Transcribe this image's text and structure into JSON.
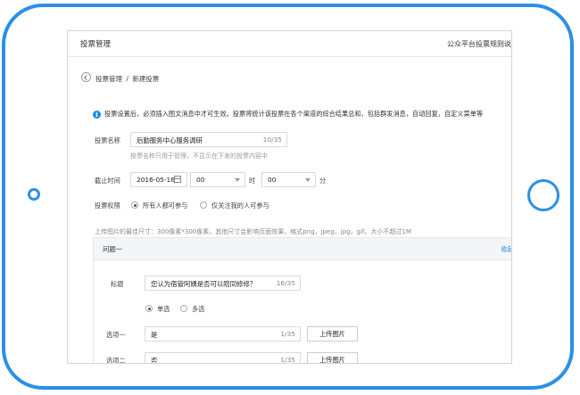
{
  "header": {
    "title": "投票管理",
    "rules_link": "公众平台投票规则说"
  },
  "breadcrumb": {
    "parent": "投票管理",
    "separator": "/",
    "current": "新建投票"
  },
  "notice": "投票设置后，必须插入图文消息中才可生效。投票将统计该投票在各个渠道的综合结果总和，包括群发消息，自动回复，自定义菜单等",
  "form": {
    "name_label": "投票名称",
    "name_value": "后勤服务中心服务调研",
    "name_count": "10/35",
    "name_hint": "投票名称只用于管理，不显示在下发的投票内容中",
    "deadline_label": "截止时间",
    "date": "2016-05-16",
    "hour": "00",
    "hour_unit": "时",
    "minute": "00",
    "minute_unit": "分",
    "permission_label": "投票权限",
    "perm_all": "所有人都可参与",
    "perm_followers": "仅关注我的人可参与",
    "image_hint": "上传图片的最佳尺寸：300像素*300像素，其他尺寸会影响页面效果，格式png，jpeg，jpg，gif。大小不超过1M"
  },
  "question": {
    "header": "问题一",
    "collapse": "收起",
    "title_label": "标题",
    "title_value": "您认为宿管阿姨是否可以陪同修修？",
    "title_count": "16/35",
    "single": "单选",
    "multi": "多选",
    "options": [
      {
        "label": "选项一",
        "value": "是",
        "count": "1/35",
        "upload": "上传图片"
      },
      {
        "label": "选项二",
        "value": "否",
        "count": "1/35",
        "upload": "上传图片"
      }
    ]
  },
  "colors": {
    "accent": "#2b8fe6",
    "info": "#1f8ae5"
  }
}
